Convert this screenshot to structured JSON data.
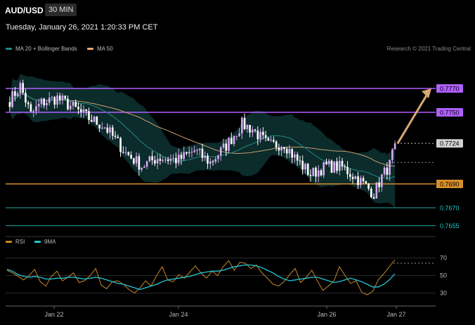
{
  "header": {
    "pair": "AUD/USD",
    "timeframe": "30 MIN",
    "datetime": "Tuesday, January 26, 2021 1:20:33 PM CET",
    "credit": "Research © 2021 Trading Central"
  },
  "legend_main": [
    {
      "label": "MA 20 + Bollinger Bands",
      "color": "#1f8a86"
    },
    {
      "label": "MA 50",
      "color": "#e8a878"
    }
  ],
  "legend_rsi": [
    {
      "label": "RSI",
      "color": "#c8882a"
    },
    {
      "label": "9MA",
      "color": "#1fc8d8"
    }
  ],
  "colors": {
    "bull": "#d7a8f0",
    "bear": "#ffffff",
    "resistance": "#b060ff",
    "pivot": "#d7902a",
    "support": "#1f8a86",
    "arrow": "#d9a873",
    "band_fill": "#0c2b2b",
    "ma20": "#1f8a86",
    "ma50": "#c8a070"
  },
  "chart_data": [
    {
      "type": "candlestick",
      "title": "AUD/USD",
      "interval": "30 MIN",
      "ylim": [
        0.765,
        0.779
      ],
      "x_tick_labels": [
        "Jan 22",
        "Jan 24",
        "Jan 26",
        "Jan 27"
      ],
      "price_path": [
        {
          "pos": 0,
          "price": 0.776
        },
        {
          "pos": 4,
          "price": 0.7772
        },
        {
          "pos": 8,
          "price": 0.7748
        },
        {
          "pos": 12,
          "price": 0.7758
        },
        {
          "pos": 18,
          "price": 0.7762
        },
        {
          "pos": 24,
          "price": 0.7754
        },
        {
          "pos": 30,
          "price": 0.7745
        },
        {
          "pos": 36,
          "price": 0.7738
        },
        {
          "pos": 44,
          "price": 0.7716
        },
        {
          "pos": 50,
          "price": 0.7705
        },
        {
          "pos": 56,
          "price": 0.7712
        },
        {
          "pos": 64,
          "price": 0.771
        },
        {
          "pos": 70,
          "price": 0.7718
        },
        {
          "pos": 76,
          "price": 0.7708
        },
        {
          "pos": 82,
          "price": 0.7722
        },
        {
          "pos": 88,
          "price": 0.774
        },
        {
          "pos": 92,
          "price": 0.7736
        },
        {
          "pos": 98,
          "price": 0.7722
        },
        {
          "pos": 104,
          "price": 0.7724
        },
        {
          "pos": 108,
          "price": 0.7712
        },
        {
          "pos": 114,
          "price": 0.7698
        },
        {
          "pos": 120,
          "price": 0.7705
        },
        {
          "pos": 126,
          "price": 0.7704
        },
        {
          "pos": 132,
          "price": 0.7694
        },
        {
          "pos": 138,
          "price": 0.7682
        },
        {
          "pos": 141,
          "price": 0.7696
        },
        {
          "pos": 144,
          "price": 0.7706
        },
        {
          "pos": 146,
          "price": 0.7724
        }
      ],
      "n_candles": 147,
      "horizontal_levels": [
        {
          "value": 0.777,
          "label": "0.7770",
          "kind": "resistance"
        },
        {
          "value": 0.775,
          "label": "0.7750",
          "kind": "resistance"
        },
        {
          "value": 0.7724,
          "label": "0.7724",
          "kind": "current"
        },
        {
          "value": 0.769,
          "label": "0.7690",
          "kind": "pivot"
        },
        {
          "value": 0.767,
          "label": "0.7670",
          "kind": "support"
        },
        {
          "value": 0.7655,
          "label": "0.7655",
          "kind": "support"
        }
      ],
      "projection": {
        "from": 0.7724,
        "to": 0.777
      }
    },
    {
      "type": "line",
      "title": "RSI",
      "ylim": [
        20,
        80
      ],
      "y_ticks": [
        30,
        50,
        70
      ],
      "series": [
        {
          "name": "RSI",
          "values": [
            56,
            53,
            49,
            45,
            50,
            57,
            43,
            38,
            49,
            55,
            44,
            48,
            53,
            42,
            44,
            50,
            58,
            39,
            35,
            43,
            44,
            40,
            34,
            30,
            36,
            44,
            38,
            50,
            60,
            45,
            43,
            51,
            47,
            54,
            61,
            53,
            47,
            55,
            50,
            60,
            67,
            56,
            65,
            64,
            58,
            62,
            53,
            47,
            40,
            38,
            43,
            51,
            58,
            42,
            48,
            56,
            44,
            33,
            38,
            44,
            60,
            50,
            41,
            44,
            31,
            28,
            32,
            45,
            52,
            60,
            68
          ]
        },
        {
          "name": "9MA",
          "values": [
            57,
            55,
            51,
            49,
            48,
            49,
            48,
            46,
            46,
            47,
            47,
            48,
            48,
            47,
            46,
            47,
            48,
            47,
            45,
            43,
            41,
            40,
            38,
            36,
            34,
            36,
            38,
            40,
            43,
            45,
            46,
            47,
            48,
            49,
            51,
            53,
            54,
            55,
            55,
            56,
            58,
            60,
            61,
            62,
            62,
            61,
            59,
            56,
            53,
            49,
            46,
            44,
            45,
            46,
            47,
            48,
            48,
            46,
            44,
            42,
            43,
            45,
            47,
            45,
            43,
            40,
            37,
            37,
            40,
            45,
            52
          ]
        },
        {
          "name": "RSI-level",
          "values": [
            64
          ]
        }
      ]
    }
  ]
}
